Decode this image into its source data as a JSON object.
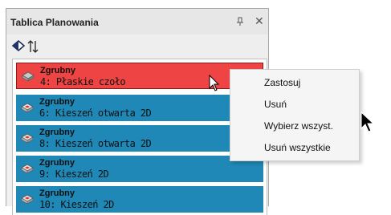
{
  "panel": {
    "title": "Tablica Planowania",
    "pin_glyph": "ᵽ",
    "close_glyph": "✕"
  },
  "toolbar": {
    "icons": [
      "diamond-icon",
      "sort-icon"
    ]
  },
  "operations": [
    {
      "name": "Zgrubny",
      "detail": "4: Płaskie czoło",
      "selected": true
    },
    {
      "name": "Zgrubny",
      "detail": "6: Kieszeń otwarta 2D",
      "selected": false
    },
    {
      "name": "Zgrubny",
      "detail": "8: Kieszeń otwarta 2D",
      "selected": false
    },
    {
      "name": "Zgrubny",
      "detail": "9: Kieszeń 2D",
      "selected": false
    },
    {
      "name": "Zgrubny",
      "detail": "10: Kieszeń 2D",
      "selected": false
    }
  ],
  "context_menu": {
    "items": [
      "Zastosuj",
      "Usuń",
      "Wybierz wszyst.",
      "Usuń wszystkie"
    ]
  },
  "colors": {
    "selected_row": "#ee4444",
    "row": "#1f88b6"
  }
}
